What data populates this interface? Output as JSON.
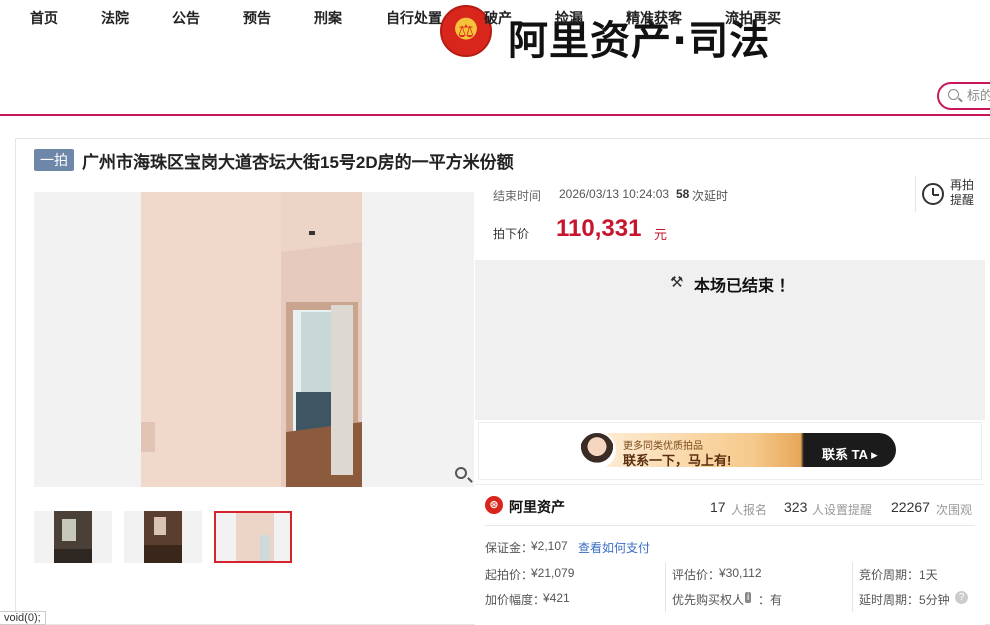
{
  "header": {
    "logo_text": "阿里资产·司法"
  },
  "nav": {
    "items": [
      "首页",
      "法院",
      "公告",
      "预告",
      "刑案",
      "自行处置",
      "破产",
      "捡漏",
      "精准获客",
      "流拍再买"
    ],
    "search_placeholder": "标的"
  },
  "listing": {
    "tag": "一拍",
    "title": "广州市海珠区宝岗大道杏坛大街15号2D房的一平方米份额",
    "end_label": "结束时间",
    "end_time": "2026/03/13 10:24:03",
    "delay_count": "58",
    "delay_suffix": "次延时",
    "price_label": "拍下价",
    "price": "110,331",
    "price_unit": "元",
    "remind_label": "再拍提醒",
    "ended_text": "本场已结束 ！"
  },
  "banner": {
    "small_text": "更多同类优质拍品",
    "big_text": "联系一下，马上有!",
    "contact": "联系 TA ▸"
  },
  "stats": {
    "brand": "阿里资产",
    "signups": "17",
    "signups_label": "人报名",
    "reminders": "323",
    "reminders_label": "人设置提醒",
    "views": "22267",
    "views_label": "次围观"
  },
  "details": {
    "deposit_label": "保证金：",
    "deposit": "¥2,107",
    "pay_link": "查看如何支付",
    "start_label": "起拍价：",
    "start": "¥21,079",
    "step_label": "加价幅度：",
    "step": "¥421",
    "eval_label": "评估价：",
    "eval": "¥30,112",
    "priority_label": "优先购买权人",
    "priority_badge": "i",
    "priority_value": "：有",
    "cycle_label": "竞价周期：",
    "cycle": "1天",
    "delay_label": "延时周期：",
    "delay": "5分钟"
  },
  "status_bar": "void(0);",
  "colors": {
    "accent": "#c8185b",
    "price": "#c8152d",
    "tag": "#6e87a8"
  }
}
